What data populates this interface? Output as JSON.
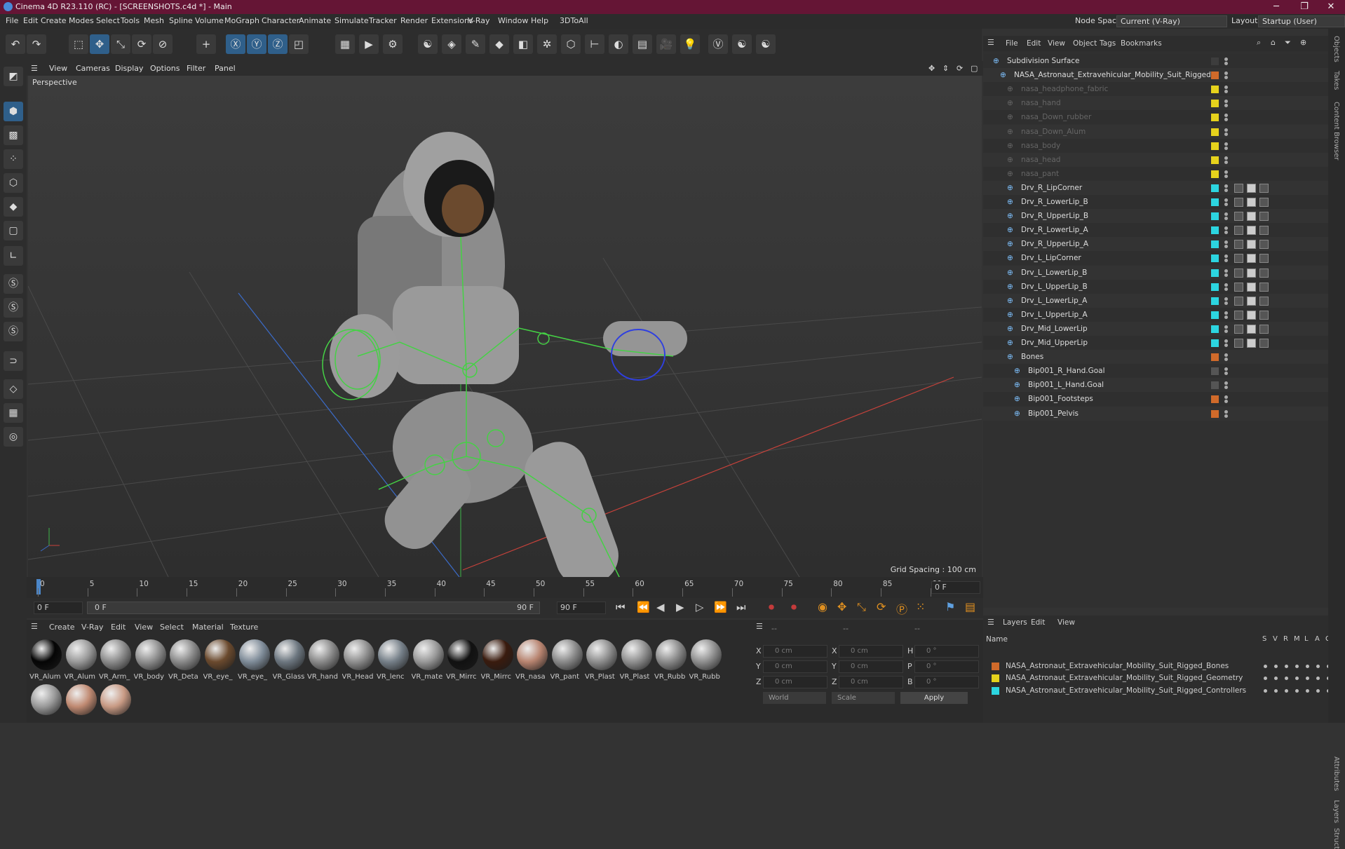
{
  "window": {
    "title": "Cinema 4D R23.110 (RC) - [SCREENSHOTS.c4d *] - Main"
  },
  "menubar": {
    "items": [
      "File",
      "Edit",
      "Create",
      "Modes",
      "Select",
      "Tools",
      "Mesh",
      "Spline",
      "Volume",
      "MoGraph",
      "Character",
      "Animate",
      "Simulate",
      "Tracker",
      "Render",
      "Extensions",
      "V-Ray",
      "Window",
      "Help",
      "3DToAll"
    ],
    "node_space_label": "Node Space:",
    "node_space_value": "Current (V-Ray)",
    "layout_label": "Layout:",
    "layout_value": "Startup (User)"
  },
  "viewport": {
    "menu": [
      "View",
      "Cameras",
      "Display",
      "Options",
      "Filter",
      "Panel"
    ],
    "label": "Perspective",
    "grid_spacing": "Grid Spacing : 100 cm"
  },
  "timeline": {
    "ticks": [
      "0",
      "5",
      "10",
      "15",
      "20",
      "25",
      "30",
      "35",
      "40",
      "45",
      "50",
      "55",
      "60",
      "65",
      "70",
      "75",
      "80",
      "85",
      "90"
    ],
    "current_frame": "0 F"
  },
  "transport": {
    "start": "0 F",
    "slider_start": "0 F",
    "slider_end": "90 F",
    "end": "90 F"
  },
  "materials": {
    "menu": [
      "Create",
      "V-Ray",
      "Edit",
      "View",
      "Select",
      "Material",
      "Texture"
    ],
    "items": [
      {
        "label": "VR_Alum",
        "color": "#050505"
      },
      {
        "label": "VR_Alum",
        "color": "#9a9a9a"
      },
      {
        "label": "VR_Arm_",
        "color": "#8c8c8c"
      },
      {
        "label": "VR_body",
        "color": "#8f8f8f"
      },
      {
        "label": "VR_Deta",
        "color": "#8a8a8a"
      },
      {
        "label": "VR_eye_",
        "color": "#6b4a2e"
      },
      {
        "label": "VR_eye_",
        "color": "#7f8c99"
      },
      {
        "label": "VR_Glass",
        "color": "#6d7780"
      },
      {
        "label": "VR_hand",
        "color": "#8a8a8a"
      },
      {
        "label": "VR_Head",
        "color": "#8f8f8f"
      },
      {
        "label": "VR_lenc",
        "color": "#768089"
      },
      {
        "label": "VR_mate",
        "color": "#999999"
      },
      {
        "label": "VR_Mirrc",
        "color": "#111111"
      },
      {
        "label": "VR_Mirrc",
        "color": "#3a1b0e"
      },
      {
        "label": "VR_nasa",
        "color": "#b88470"
      },
      {
        "label": "VR_pant",
        "color": "#8a8a8a"
      },
      {
        "label": "VR_Plast",
        "color": "#8e8e8e"
      },
      {
        "label": "VR_Plast",
        "color": "#909090"
      },
      {
        "label": "VR_Rubb",
        "color": "#8b8b8b"
      },
      {
        "label": "VR_Rubb",
        "color": "#8f8f8f"
      },
      {
        "label": "",
        "color": "#9a9a9a"
      },
      {
        "label": "",
        "color": "#c08a72"
      },
      {
        "label": "",
        "color": "#c89a84"
      }
    ]
  },
  "coords": {
    "header_left": "--",
    "header_mid": "--",
    "header_right": "--",
    "rows": [
      {
        "a": "X",
        "av": "0 cm",
        "b": "X",
        "bv": "0 cm",
        "c": "H",
        "cv": "0 °"
      },
      {
        "a": "Y",
        "av": "0 cm",
        "b": "Y",
        "bv": "0 cm",
        "c": "P",
        "cv": "0 °"
      },
      {
        "a": "Z",
        "av": "0 cm",
        "b": "Z",
        "bv": "0 cm",
        "c": "B",
        "cv": "0 °"
      }
    ],
    "world": "World",
    "scale": "Scale",
    "apply": "Apply"
  },
  "objects": {
    "menu": [
      "File",
      "Edit",
      "View",
      "Object",
      "Tags",
      "Bookmarks"
    ],
    "rows": [
      {
        "name": "Subdivision Surface",
        "indent": 0,
        "dim": false,
        "color": "#3d3d3d"
      },
      {
        "name": "NASA_Astronaut_Extravehicular_Mobility_Suit_Rigged",
        "indent": 1,
        "dim": false,
        "color": "#d06a2a"
      },
      {
        "name": "nasa_headphone_fabric",
        "indent": 2,
        "dim": true,
        "color": "#e6d21c"
      },
      {
        "name": "nasa_hand",
        "indent": 2,
        "dim": true,
        "color": "#e6d21c"
      },
      {
        "name": "nasa_Down_rubber",
        "indent": 2,
        "dim": true,
        "color": "#e6d21c"
      },
      {
        "name": "nasa_Down_Alum",
        "indent": 2,
        "dim": true,
        "color": "#e6d21c"
      },
      {
        "name": "nasa_body",
        "indent": 2,
        "dim": true,
        "color": "#e6d21c"
      },
      {
        "name": "nasa_head",
        "indent": 2,
        "dim": true,
        "color": "#e6d21c"
      },
      {
        "name": "nasa_pant",
        "indent": 2,
        "dim": true,
        "color": "#e6d21c"
      },
      {
        "name": "Drv_R_LipCorner",
        "indent": 2,
        "dim": false,
        "color": "#2cd5e0"
      },
      {
        "name": "Drv_R_LowerLip_B",
        "indent": 2,
        "dim": false,
        "color": "#2cd5e0"
      },
      {
        "name": "Drv_R_UpperLip_B",
        "indent": 2,
        "dim": false,
        "color": "#2cd5e0"
      },
      {
        "name": "Drv_R_LowerLip_A",
        "indent": 2,
        "dim": false,
        "color": "#2cd5e0"
      },
      {
        "name": "Drv_R_UpperLip_A",
        "indent": 2,
        "dim": false,
        "color": "#2cd5e0"
      },
      {
        "name": "Drv_L_LipCorner",
        "indent": 2,
        "dim": false,
        "color": "#2cd5e0"
      },
      {
        "name": "Drv_L_LowerLip_B",
        "indent": 2,
        "dim": false,
        "color": "#2cd5e0"
      },
      {
        "name": "Drv_L_UpperLip_B",
        "indent": 2,
        "dim": false,
        "color": "#2cd5e0"
      },
      {
        "name": "Drv_L_LowerLip_A",
        "indent": 2,
        "dim": false,
        "color": "#2cd5e0"
      },
      {
        "name": "Drv_L_UpperLip_A",
        "indent": 2,
        "dim": false,
        "color": "#2cd5e0"
      },
      {
        "name": "Drv_Mid_LowerLip",
        "indent": 2,
        "dim": false,
        "color": "#2cd5e0"
      },
      {
        "name": "Drv_Mid_UpperLip",
        "indent": 2,
        "dim": false,
        "color": "#2cd5e0"
      },
      {
        "name": "Bones",
        "indent": 2,
        "dim": false,
        "color": "#d06a2a"
      },
      {
        "name": "Bip001_R_Hand.Goal",
        "indent": 3,
        "dim": false,
        "color": "#555555"
      },
      {
        "name": "Bip001_L_Hand.Goal",
        "indent": 3,
        "dim": false,
        "color": "#555555"
      },
      {
        "name": "Bip001_Footsteps",
        "indent": 3,
        "dim": false,
        "color": "#d06a2a"
      },
      {
        "name": "Bip001_Pelvis",
        "indent": 3,
        "dim": false,
        "color": "#d06a2a"
      }
    ]
  },
  "layers": {
    "menu": [
      "Layers",
      "Edit",
      "View"
    ],
    "col_name": "Name",
    "cols": [
      "S",
      "V",
      "R",
      "M",
      "L",
      "A",
      "G"
    ],
    "rows": [
      {
        "name": "NASA_Astronaut_Extravehicular_Mobility_Suit_Rigged_Bones",
        "color": "#d06a2a"
      },
      {
        "name": "NASA_Astronaut_Extravehicular_Mobility_Suit_Rigged_Geometry",
        "color": "#e6d21c"
      },
      {
        "name": "NASA_Astronaut_Extravehicular_Mobility_Suit_Rigged_Controllers",
        "color": "#2cd5e0"
      }
    ]
  },
  "side_tabs": [
    "Objects",
    "Takes",
    "Content Browser",
    "Attributes",
    "Layers",
    "Struct"
  ]
}
